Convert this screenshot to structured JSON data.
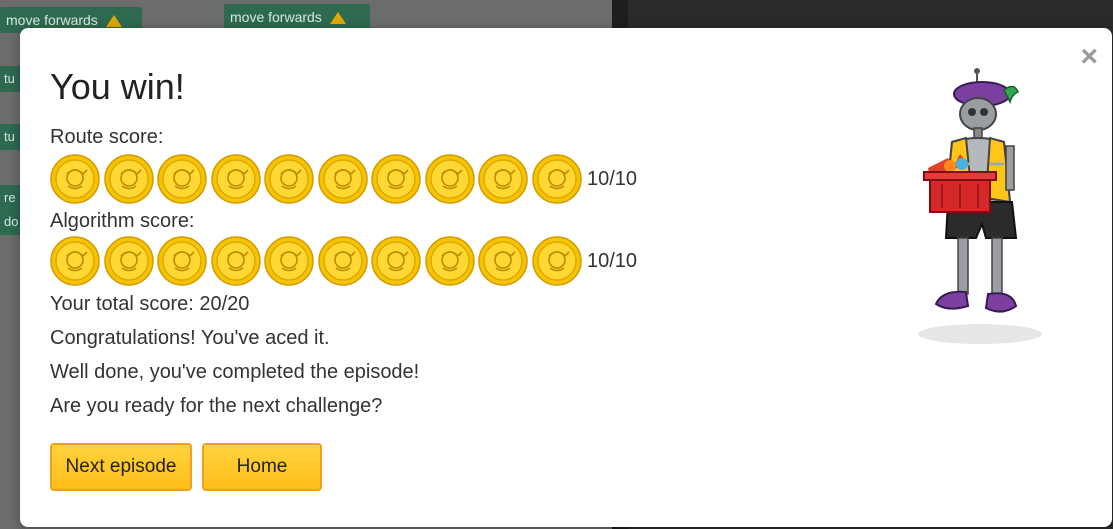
{
  "workspace": {
    "block_top_left": "move forwards",
    "block_top_mid": "move forwards",
    "side_blocks": [
      "tu",
      "tu",
      "re",
      "do"
    ]
  },
  "dialog": {
    "title": "You win!",
    "close_label": "×",
    "route_score": {
      "label": "Route score:",
      "coins_earned": 10,
      "coins_total": 10,
      "value_text": "10/10"
    },
    "algorithm_score": {
      "label": "Algorithm score:",
      "coins_earned": 10,
      "coins_total": 10,
      "value_text": "10/10"
    },
    "total_score": "Your total score: 20/20",
    "messages": [
      "Congratulations! You've aced it.",
      "Well done, you've completed the episode!",
      "Are you ready for the next challenge?"
    ],
    "buttons": {
      "next_label": "Next episode",
      "home_label": "Home"
    }
  },
  "icons": {
    "coin": "gold-coin-icon",
    "close": "close-icon",
    "arrow": "up-arrow-icon",
    "character": "robot-character"
  },
  "colors": {
    "button_fill": "#ffc825",
    "button_border": "#f0a020",
    "coin_gold": "#f5c400",
    "block_green": "#2d6a4f"
  }
}
